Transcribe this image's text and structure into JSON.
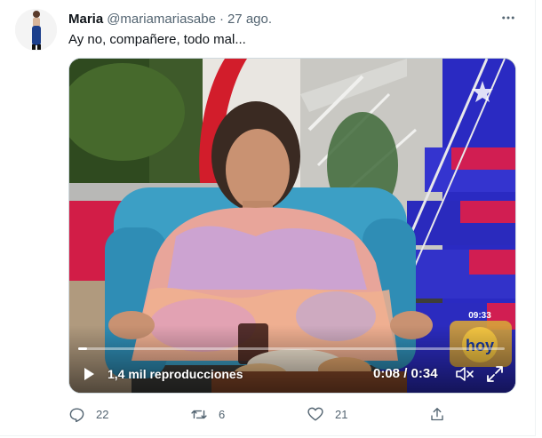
{
  "tweet": {
    "author_name": "Maria",
    "author_handle": "@mariamariasabe",
    "separator": "·",
    "date": "27 ago.",
    "text": "Ay no, compañere, todo mal..."
  },
  "video": {
    "views": "1,4 mil reproducciones",
    "time": "0:08 / 0:34",
    "progress_fraction": 0.02,
    "channel_clock": "09:33",
    "channel_logo_text": "hoy"
  },
  "actions": {
    "replies": "22",
    "retweets": "6",
    "likes": "21"
  },
  "colors": {
    "text_primary": "#0f1419",
    "text_secondary": "#536471",
    "border": "#cfd9de"
  },
  "icons": {
    "more": "more-icon",
    "reply": "reply-icon",
    "retweet": "retweet-icon",
    "like": "like-icon",
    "share": "share-icon",
    "play": "play-icon",
    "mute": "mute-icon",
    "fullscreen": "fullscreen-icon"
  }
}
